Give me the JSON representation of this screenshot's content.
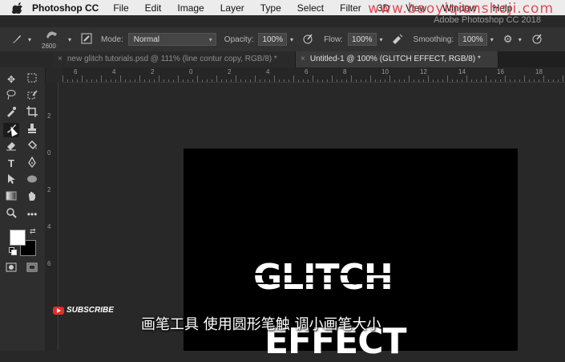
{
  "menubar": {
    "app": "Photoshop CC",
    "items": [
      "File",
      "Edit",
      "Image",
      "Layer",
      "Type",
      "Select",
      "Filter",
      "3D",
      "View",
      "Window",
      "Help"
    ],
    "watermark": "www.baoyiqianshoji.com",
    "window_title": "Adobe Photoshop CC 2018"
  },
  "options": {
    "brush_size": "2600",
    "mode_label": "Mode:",
    "mode_value": "Normal",
    "opacity_label": "Opacity:",
    "opacity_value": "100%",
    "flow_label": "Flow:",
    "flow_value": "100%",
    "smoothing_label": "Smoothing:",
    "smoothing_value": "100%"
  },
  "tabs": [
    {
      "label": "new glitch tutorials.psd @ 111% (line contur copy, RGB/8) *",
      "active": false
    },
    {
      "label": "Untitled-1 @ 100% (GLITCH EFFECT, RGB/8) *",
      "active": true
    }
  ],
  "ruler": {
    "top": [
      "6",
      "4",
      "2",
      "0",
      "2",
      "4",
      "6",
      "8",
      "10",
      "12",
      "14",
      "16",
      "18"
    ],
    "left": [
      "2",
      "0",
      "2",
      "4",
      "6"
    ]
  },
  "canvas": {
    "text_line1": "GLITCH",
    "text_line2": "EFFECT"
  },
  "overlay": {
    "subtitle": "画笔工具 使用圆形笔触 调小画笔大小",
    "subscribe": "SUBSCRIBE"
  },
  "colors": {
    "foreground": "#ffffff",
    "background": "#000000"
  }
}
